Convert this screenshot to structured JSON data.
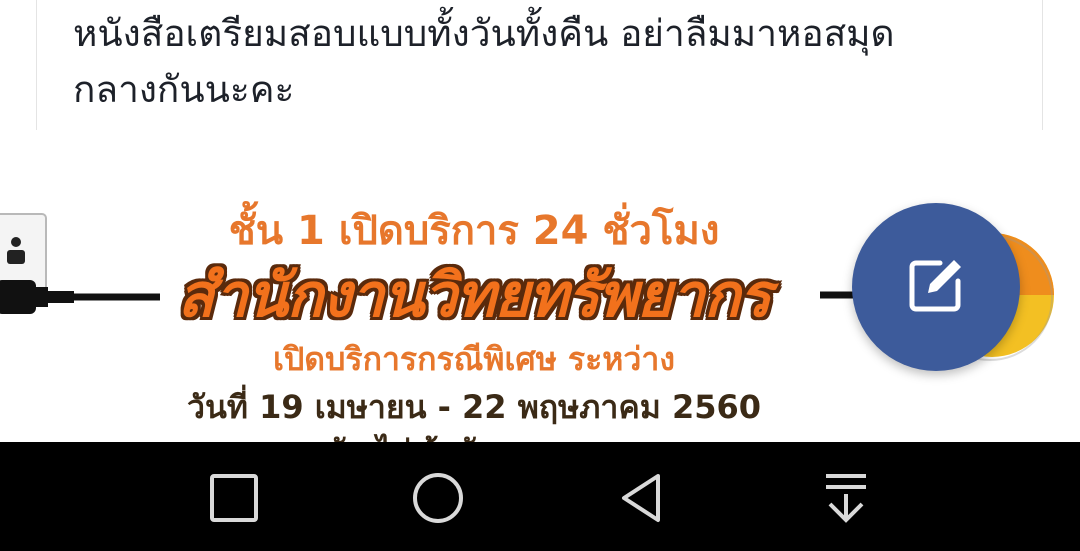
{
  "post": {
    "text_line1": "หนังสือเตรียมสอบแบบทั้งวันทั้งคืน อย่าลืมมาหอสมุด",
    "text_line2": "กลางกันนะคะ"
  },
  "poster": {
    "line1": "ชั้น 1 เปิดบริการ 24 ชั่วโมง",
    "line2": "สำนักงานวิทยทรัพยากร",
    "line3": "เปิดบริการกรณีพิเศษ ระหว่าง",
    "line4": "วันที่ 19 เมษายน - 22 พฤษภาคม 2560",
    "line5": "ทุกวัน ไม่เว้นวันหยุดราชการ"
  },
  "fab": {
    "icon": "edit-icon",
    "color": "#3d5b9b"
  },
  "navbar": {
    "buttons": [
      {
        "icon": "recent-apps-icon"
      },
      {
        "icon": "home-icon"
      },
      {
        "icon": "back-icon"
      },
      {
        "icon": "notification-pull-down-icon"
      }
    ]
  }
}
